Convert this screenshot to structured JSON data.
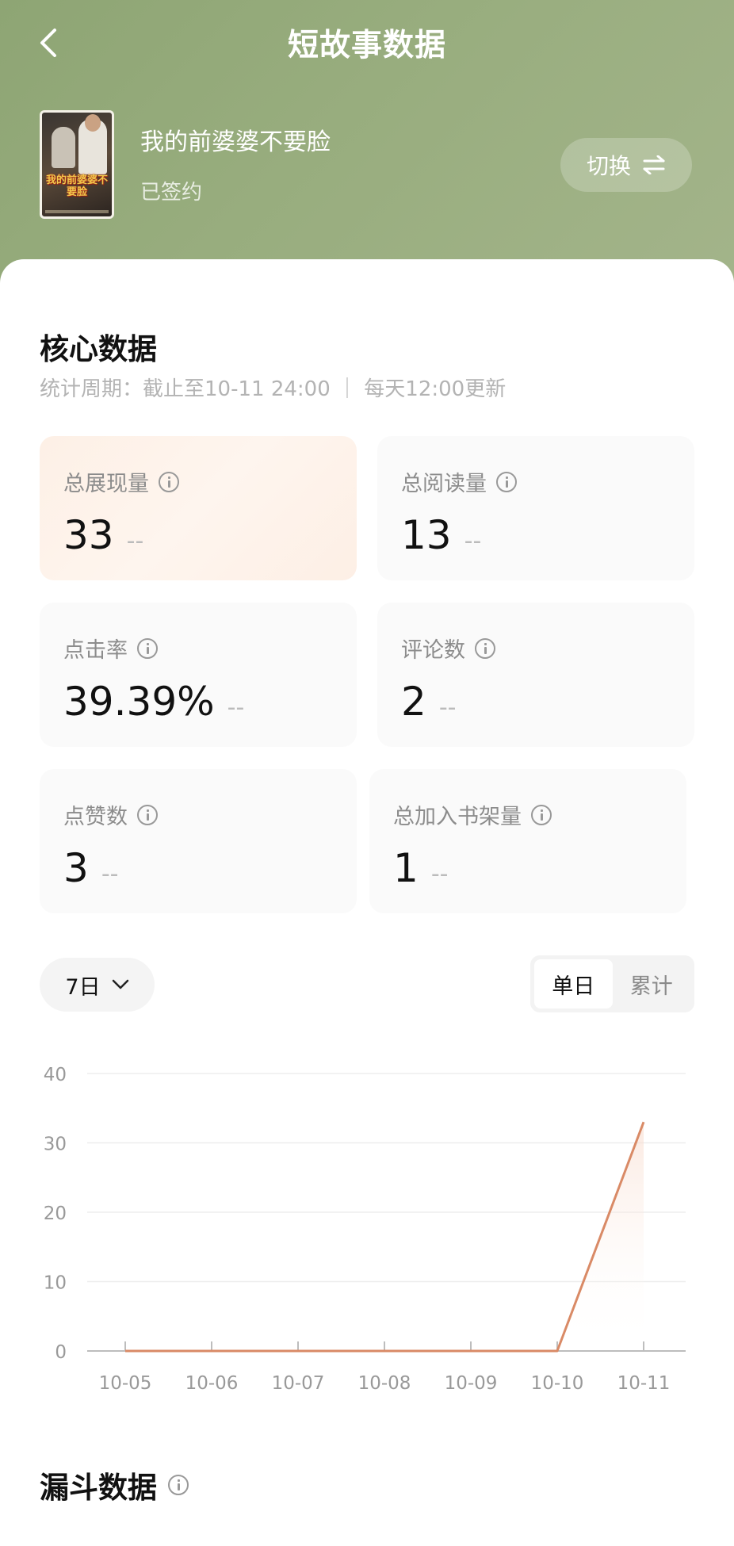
{
  "header": {
    "title": "短故事数据",
    "book_title": "我的前婆婆不要脸",
    "book_status": "已签约",
    "cover_text": "我的前婆婆不要脸",
    "switch_label": "切换",
    "background_color": "#98ad7e"
  },
  "core": {
    "title": "核心数据",
    "period": "统计周期：截止至10-11 24:00 ｜ 每天12:00更新"
  },
  "metrics": [
    {
      "label": "总展现量",
      "value": "33",
      "trend": "--"
    },
    {
      "label": "总阅读量",
      "value": "13",
      "trend": "--"
    },
    {
      "label": "点击率",
      "value": "39.39%",
      "trend": "--"
    },
    {
      "label": "评论数",
      "value": "2",
      "trend": "--"
    },
    {
      "label": "点赞数",
      "value": "3",
      "trend": "--"
    },
    {
      "label": "总加入书架量",
      "value": "1",
      "trend": "--"
    }
  ],
  "controls": {
    "range_label": "7日",
    "tabs": [
      "单日",
      "累计"
    ],
    "active_tab": "单日"
  },
  "chart_data": {
    "type": "line",
    "x": [
      "10-05",
      "10-06",
      "10-07",
      "10-08",
      "10-09",
      "10-10",
      "10-11"
    ],
    "series": [
      {
        "values": [
          0,
          0,
          0,
          0,
          0,
          0,
          33
        ],
        "color": "#d98a66"
      }
    ],
    "yticks": [
      0,
      10,
      20,
      30,
      40
    ],
    "ylim": [
      0,
      40
    ],
    "grid": true
  },
  "funnel": {
    "title": "漏斗数据"
  }
}
